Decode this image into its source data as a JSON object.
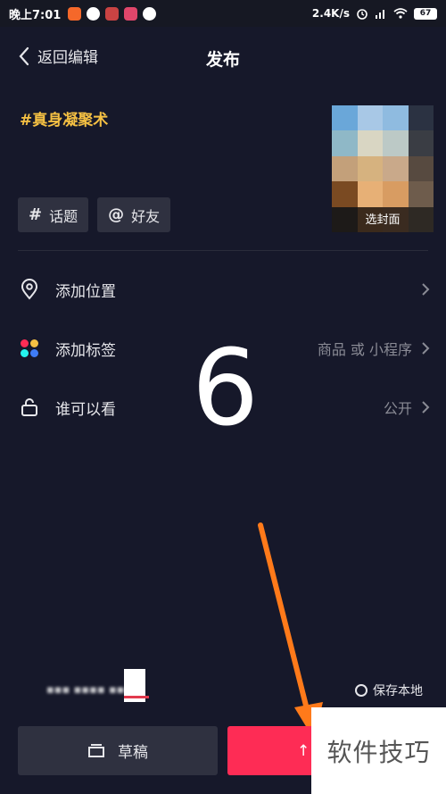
{
  "status_bar": {
    "time": "晚上7:01",
    "network_speed": "2.4K/s",
    "battery": "67",
    "app_icon_colors": [
      "#f5682a",
      "#e83b3b",
      "#c94343",
      "#e0466b",
      "#ffffff"
    ]
  },
  "header": {
    "back_label": "返回编辑",
    "title": "发布"
  },
  "caption": "#真身凝聚术",
  "cover": {
    "label": "选封面",
    "pixel_colors": [
      "#6aa7d9",
      "#a8c8e6",
      "#8fbbe0",
      "#2b3242",
      "#8fb8c7",
      "#d9d6c3",
      "#bcc9c6",
      "#3a3d44",
      "#c3a07a",
      "#d6b27f",
      "#c9a98a",
      "#574a40",
      "#7a4a22",
      "#e7b076",
      "#d89c62",
      "#6e5c4c",
      "#1d1a18",
      "#3b2a1c",
      "#3a2b20",
      "#2e2924"
    ]
  },
  "chips": {
    "topic_symbol": "#",
    "topic": "话题",
    "friend_symbol": "@",
    "friend": "好友"
  },
  "rows": {
    "location": "添加位置",
    "tag": "添加标签",
    "tag_value": "商品 或 小程序",
    "visibility": "谁可以看",
    "visibility_value": "公开"
  },
  "overlay_number": "6",
  "save_local": "保存本地",
  "buttons": {
    "draft": "草稿",
    "publish_icon": "↑"
  },
  "watermark": "软件技巧",
  "colors": {
    "accent": "#fe2c55",
    "caption": "#f5c043",
    "background": "#16182a",
    "arrow": "#ff7a1a"
  }
}
